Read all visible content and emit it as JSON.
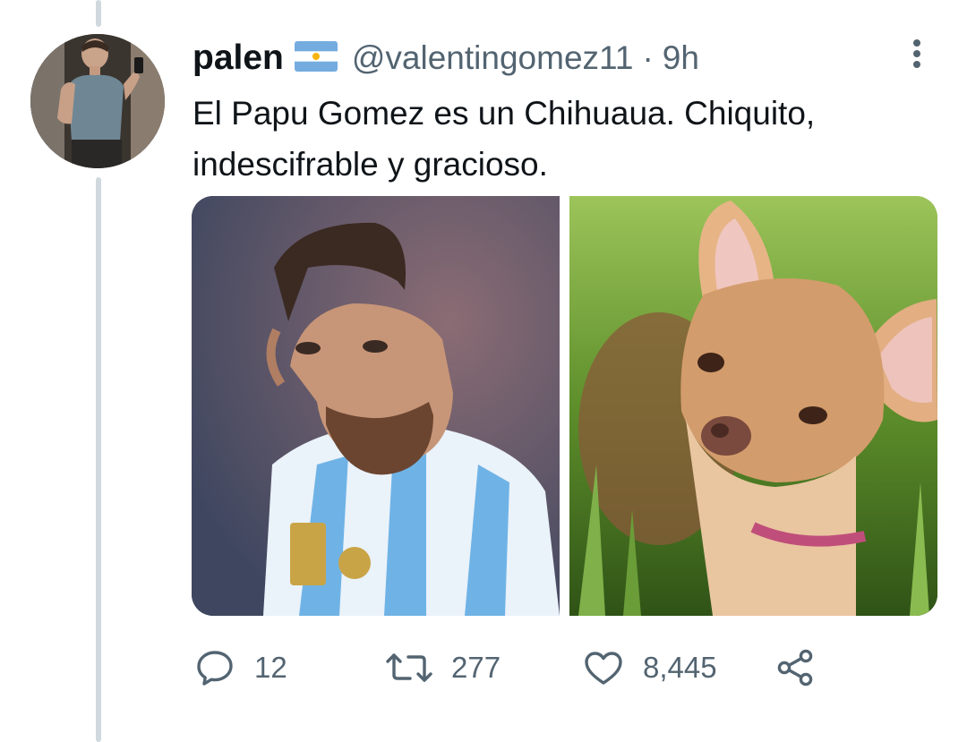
{
  "author": {
    "name": "palen",
    "handle": "@valentingomez11",
    "separator": "·",
    "time": "9h",
    "flag_icon": "argentina-flag-icon"
  },
  "tweet": {
    "text": "El Papu Gomez es un Chihuaua. Chiquito,\nindescifrable y gracioso."
  },
  "media": {
    "left_image": "photo of a footballer in a light blue and white striped jersey",
    "right_image": "photo of a chihuahua dog on grass"
  },
  "actions": {
    "reply": {
      "icon": "reply-icon",
      "count": "12"
    },
    "retweet": {
      "icon": "retweet-icon",
      "count": "277"
    },
    "like": {
      "icon": "heart-icon",
      "count": "8,445"
    },
    "share": {
      "icon": "share-icon"
    }
  },
  "colors": {
    "text": "#0f1419",
    "secondary": "#536471",
    "thread_line": "#cfd9de"
  }
}
